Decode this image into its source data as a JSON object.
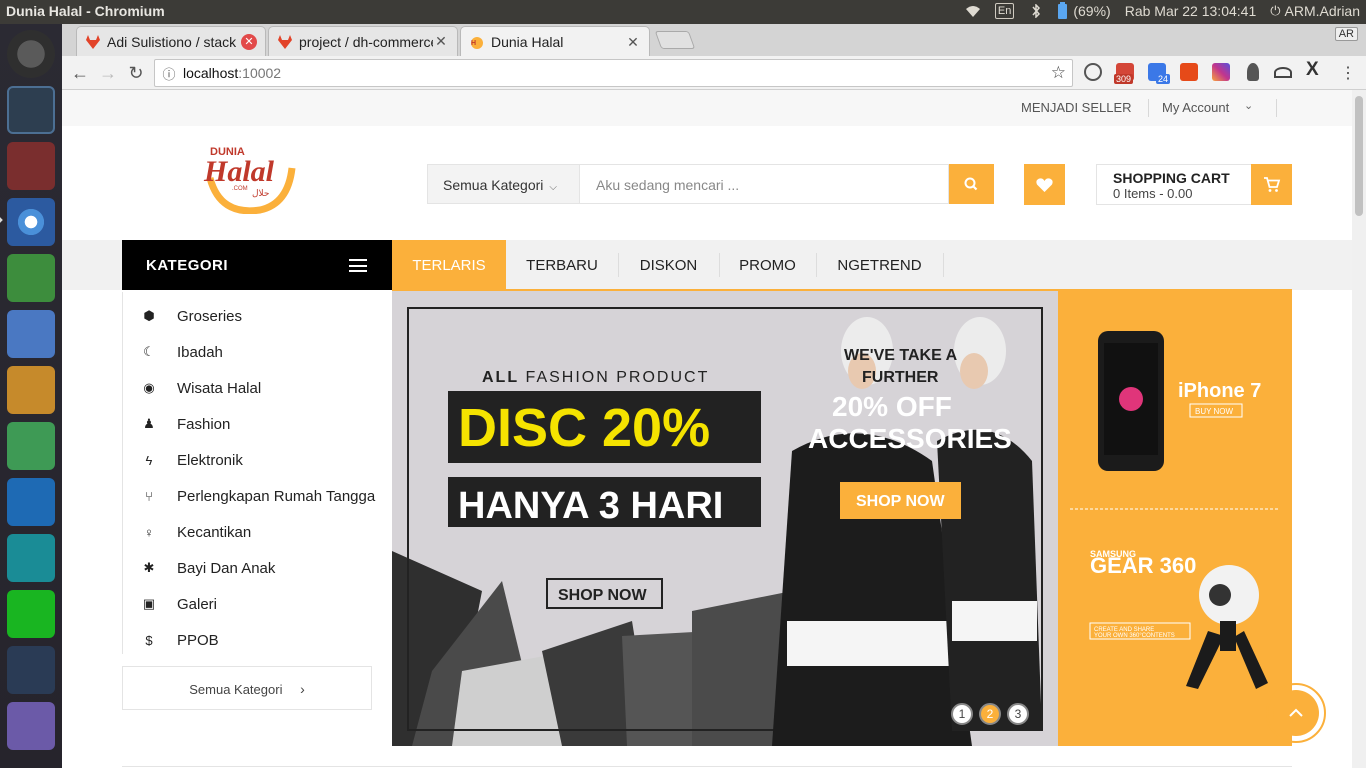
{
  "os": {
    "window_title": "Dunia Halal - Chromium",
    "lang": "En",
    "battery": "(69%)",
    "clock": "Rab Mar 22 13:04:41",
    "user": "ARM.Adrian"
  },
  "browser": {
    "tabs": [
      {
        "label": "Adi Sulistiono / stack"
      },
      {
        "label": "project / dh-commerce"
      },
      {
        "label": "Dunia Halal"
      }
    ],
    "profile": "AR",
    "url_host": "localhost",
    "url_port": ":10002",
    "ext_badges": {
      "gmail": "309",
      "calendar": "24"
    }
  },
  "topbar": {
    "seller": "MENJADI SELLER",
    "account": "My Account"
  },
  "logo": {
    "main": "Halal",
    "top": "DUNIA",
    "com": ".COM",
    "ar": "حلال"
  },
  "search": {
    "category": "Semua Kategori",
    "placeholder": "Aku sedang mencari ..."
  },
  "cart": {
    "title": "SHOPPING CART",
    "summary": "0 Items - 0.00"
  },
  "nav": {
    "kategori": "KATEGORI",
    "items": [
      "TERLARIS",
      "TERBARU",
      "DISKON",
      "PROMO",
      "NGETREND"
    ]
  },
  "categories": {
    "items": [
      {
        "label": "Groseries",
        "icon": "cube-icon"
      },
      {
        "label": "Ibadah",
        "icon": "moon-icon"
      },
      {
        "label": "Wisata Halal",
        "icon": "binoculars-icon"
      },
      {
        "label": "Fashion",
        "icon": "male-icon"
      },
      {
        "label": "Elektronik",
        "icon": "bolt-icon"
      },
      {
        "label": "Perlengkapan Rumah Tangga",
        "icon": "cutlery-icon"
      },
      {
        "label": "Kecantikan",
        "icon": "female-icon"
      },
      {
        "label": "Bayi Dan Anak",
        "icon": "child-icon"
      },
      {
        "label": "Galeri",
        "icon": "image-icon"
      },
      {
        "label": "PPOB",
        "icon": "dollar-icon"
      }
    ],
    "all": "Semua Kategori"
  },
  "banner": {
    "all_fashion_bold": "ALL",
    "all_fashion_rest": " FASHION PRODUCT",
    "disc": "DISC 20%",
    "hari": "HANYA 3 HARI",
    "shop_left": "SHOP NOW",
    "tagline1": "WE'VE TAKE A",
    "tagline2": "FURTHER",
    "off": "20% OFF",
    "acc": "ACCESSORIES",
    "shop_right": "SHOP NOW",
    "dots": [
      "1",
      "2",
      "3"
    ],
    "active_dot": 2
  },
  "side": {
    "iphone": "iPhone 7",
    "buy": "BUY NOW",
    "samsung": "SAMSUNG",
    "gear": "GEAR 360",
    "create1": "CREATE AND SHARE",
    "create2": "YOUR OWN 360°CONTENTS"
  },
  "colors": {
    "accent": "#fbb03b",
    "dark": "#000000"
  }
}
